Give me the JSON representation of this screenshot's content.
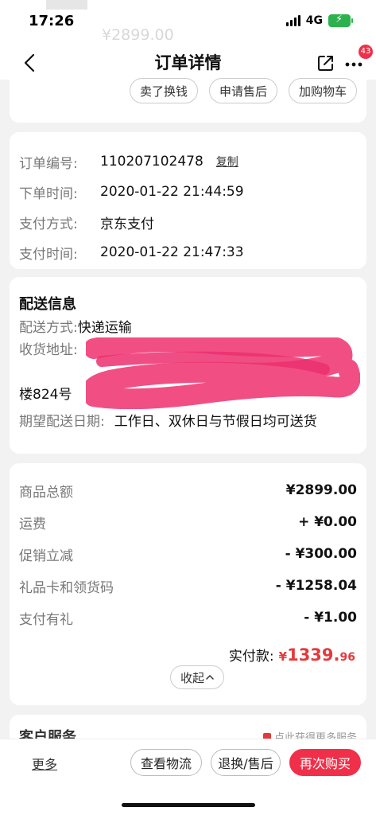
{
  "status": {
    "time": "17:26",
    "network": "4G"
  },
  "ghost": {
    "price": "¥2899.00"
  },
  "nav": {
    "title": "订单详情",
    "badge_count": "43"
  },
  "actions": {
    "buttons": [
      "卖了换钱",
      "申请售后",
      "加购物车"
    ]
  },
  "order": {
    "number_label": "订单编号:",
    "number_value": "110207102478",
    "copy_label": "复制",
    "order_time_label": "下单时间:",
    "order_time_value": "2020-01-22 21:44:59",
    "pay_method_label": "支付方式:",
    "pay_method_value": "京东支付",
    "pay_time_label": "支付时间:",
    "pay_time_value": "2020-01-22 21:47:33"
  },
  "shipping": {
    "title": "配送信息",
    "method_label": "配送方式:",
    "method_value": "快递运输",
    "address_label": "收货地址:",
    "address_visible_tail": "楼824号",
    "expected_label": "期望配送日期:",
    "expected_value": "工作日、双休日与节假日均可送货"
  },
  "payment": {
    "rows": [
      {
        "label": "商品总额",
        "value": "¥2899.00"
      },
      {
        "label": "运费",
        "value": "+ ¥0.00"
      },
      {
        "label": "促销立减",
        "value": "- ¥300.00"
      },
      {
        "label": "礼品卡和领货码",
        "value": "- ¥1258.04"
      },
      {
        "label": "支付有礼",
        "value": "- ¥1.00"
      }
    ],
    "paid_label": "实付款:",
    "paid_symbol": "¥",
    "paid_int": "1339.",
    "paid_dec": "96",
    "collapse_label": "收起"
  },
  "service": {
    "title": "客户服务",
    "hint": "点此获得更多服务"
  },
  "bottom": {
    "more": "更多",
    "logistics": "查看物流",
    "return": "退换/售后",
    "rebuy": "再次购买"
  },
  "colors": {
    "accent": "#f0304a",
    "price_red": "#e4393c",
    "redaction": "#f0407a"
  }
}
